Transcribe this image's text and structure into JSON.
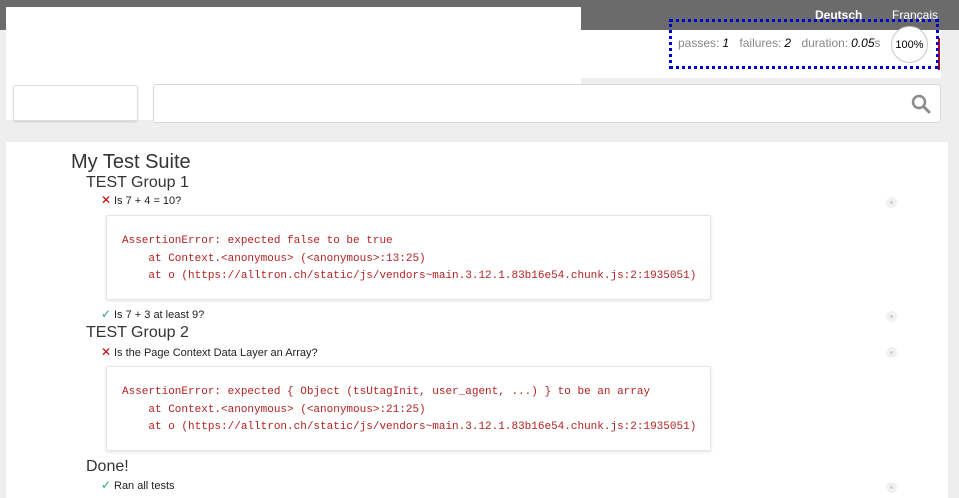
{
  "languages": {
    "de": "Deutsch",
    "fr": "Français"
  },
  "stats": {
    "passes_label": "passes:",
    "passes": "1",
    "failures_label": "failures:",
    "failures": "2",
    "duration_label": "duration:",
    "duration": "0.05",
    "duration_unit": "s",
    "progress_text": "100%",
    "progress": 1.0
  },
  "suite": {
    "title": "My Test Suite",
    "groups": [
      {
        "title": "TEST Group 1",
        "tests": [
          {
            "status": "fail",
            "title": "Is 7 + 4 = 10?",
            "error": "AssertionError: expected false to be true\n    at Context.<anonymous> (<anonymous>:13:25)\n    at o (https://alltron.ch/static/js/vendors~main.3.12.1.83b16e54.chunk.js:2:1935051)"
          },
          {
            "status": "pass",
            "title": "Is 7 + 3 at least 9?"
          }
        ]
      },
      {
        "title": "TEST Group 2",
        "tests": [
          {
            "status": "fail",
            "title": "Is the Page Context Data Layer an Array?",
            "error": "AssertionError: expected { Object (tsUtagInit, user_agent, ...) } to be an array\n    at Context.<anonymous> (<anonymous>:21:25)\n    at o (https://alltron.ch/static/js/vendors~main.3.12.1.83b16e54.chunk.js:2:1935051)"
          }
        ]
      },
      {
        "title": "Done!",
        "tests": [
          {
            "status": "pass",
            "title": "Ran all tests"
          }
        ]
      }
    ]
  },
  "icons": {
    "fail": "✕",
    "pass": "✓",
    "search": "search-icon"
  },
  "colors": {
    "fail": "#cc0000",
    "pass": "#2aa872",
    "error_text": "#b22222",
    "highlight_border": "#0000cc"
  }
}
